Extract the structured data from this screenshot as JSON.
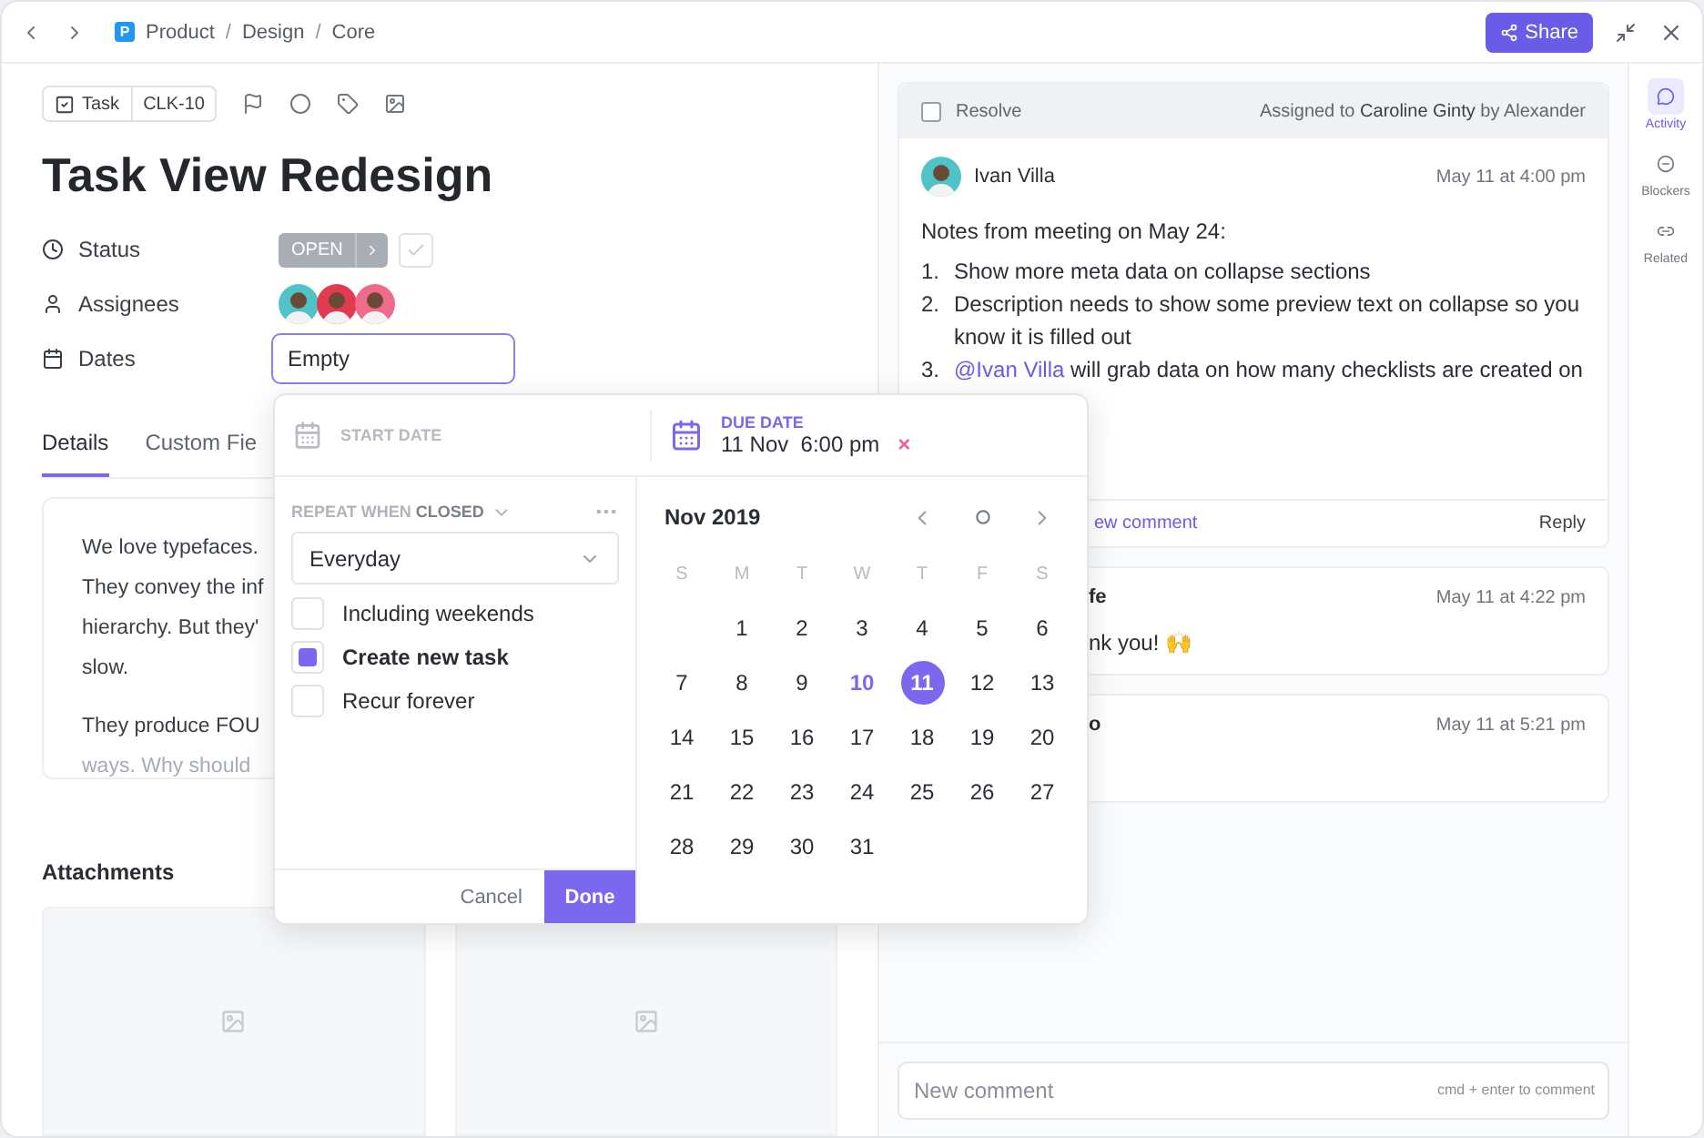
{
  "topbar": {
    "space_badge": "P",
    "breadcrumb": [
      "Product",
      "Design",
      "Core"
    ],
    "separators": [
      "/",
      "/"
    ],
    "share": "Share"
  },
  "task": {
    "type_label": "Task",
    "id": "CLK-10",
    "title": "Task View Redesign"
  },
  "fields": {
    "status_label": "Status",
    "status_value": "OPEN",
    "complete": false,
    "assignees_label": "Assignees",
    "dates_label": "Dates",
    "dates_value": "Empty"
  },
  "tabs": [
    {
      "label": "Details",
      "selected": true
    },
    {
      "label": "Custom Fie",
      "selected": false
    }
  ],
  "description": {
    "paragraphs": [
      [
        "We love typefaces.",
        "They convey the inf",
        "hierarchy. But they'",
        "slow."
      ],
      [
        "They produce FOU",
        "ways. Why should"
      ]
    ]
  },
  "attachments": {
    "title": "Attachments",
    "items": [
      {
        "kind": "placeholder"
      },
      {
        "kind": "placeholder"
      }
    ]
  },
  "activity": {
    "resolve": {
      "label": "Resolve",
      "checked": false
    },
    "assigned": "Assigned to **Caroline Ginty** by Alexander",
    "comments": [
      {
        "author": "Ivan Villa",
        "time": "May 11 at 4:00 pm",
        "intro": "Notes from meeting on May 24:",
        "items": [
          {
            "number": "1.",
            "text": "Show more meta data on collapse sections"
          },
          {
            "number": "2.",
            "text": "Description needs to show some preview text on collapse so you know it is filled out"
          },
          {
            "number": "3.",
            "mention": "@Ivan Villa",
            "text": " will grab data on how many checklists are created on"
          }
        ],
        "link": "ew comment",
        "reply": "Reply"
      },
      {
        "author": "fe",
        "time": "May 11 at 4:22 pm",
        "body": "nk you! 🙌"
      },
      {
        "author": "o",
        "time": "May 11 at 5:21 pm"
      }
    ],
    "new_comment": {
      "placeholder": "New comment",
      "hint": "cmd + enter to comment"
    }
  },
  "side_tabs": [
    {
      "label": "Activity",
      "selected": true
    },
    {
      "label": "Blockers",
      "selected": false
    },
    {
      "label": "Related",
      "selected": false
    }
  ],
  "date_popup": {
    "start_label": "START DATE",
    "due_label": "DUE DATE",
    "due_value": "11 Nov  6:00 pm",
    "clear": "×",
    "repeat_label": "REPEAT WHEN **CLOSED**",
    "repeat_value": "Everyday",
    "options": [
      {
        "label": "Including weekends",
        "checked": false
      },
      {
        "label": "Create new task",
        "checked": true
      },
      {
        "label": "Recur forever",
        "checked": false
      }
    ],
    "cancel": "Cancel",
    "done": "Done",
    "calendar": {
      "month": "Nov 2019",
      "weekdays": [
        "S",
        "M",
        "T",
        "W",
        "T",
        "F",
        "S"
      ],
      "weeks": [
        [
          {
            "label": "1",
            "today": false,
            "selected": false
          },
          {
            "label": "2",
            "today": false,
            "selected": false
          },
          {
            "label": "3",
            "today": false,
            "selected": false
          },
          {
            "label": "4",
            "today": false,
            "selected": false
          },
          {
            "label": "5",
            "today": false,
            "selected": false
          },
          {
            "label": "6",
            "today": false,
            "selected": false
          }
        ],
        [
          {
            "label": "7",
            "today": false,
            "selected": false
          },
          {
            "label": "8",
            "today": false,
            "selected": false
          },
          {
            "label": "9",
            "today": false,
            "selected": false
          },
          {
            "label": "10",
            "today": true,
            "selected": false
          },
          {
            "label": "11",
            "today": false,
            "selected": true
          },
          {
            "label": "12",
            "today": false,
            "selected": false
          },
          {
            "label": "13",
            "today": false,
            "selected": false
          }
        ],
        [
          {
            "label": "14",
            "today": false,
            "selected": false
          },
          {
            "label": "15",
            "today": false,
            "selected": false
          },
          {
            "label": "16",
            "today": false,
            "selected": false
          },
          {
            "label": "17",
            "today": false,
            "selected": false
          },
          {
            "label": "18",
            "today": false,
            "selected": false
          },
          {
            "label": "19",
            "today": false,
            "selected": false
          },
          {
            "label": "20",
            "today": false,
            "selected": false
          }
        ],
        [
          {
            "label": "21",
            "today": false,
            "selected": false
          },
          {
            "label": "22",
            "today": false,
            "selected": false
          },
          {
            "label": "23",
            "today": false,
            "selected": false
          },
          {
            "label": "24",
            "today": false,
            "selected": false
          },
          {
            "label": "25",
            "today": false,
            "selected": false
          },
          {
            "label": "26",
            "today": false,
            "selected": false
          },
          {
            "label": "27",
            "today": false,
            "selected": false
          }
        ],
        [
          {
            "label": "28",
            "today": false,
            "selected": false
          },
          {
            "label": "29",
            "today": false,
            "selected": false
          },
          {
            "label": "30",
            "today": false,
            "selected": false
          },
          {
            "label": "31",
            "today": false,
            "selected": false
          }
        ]
      ]
    }
  }
}
